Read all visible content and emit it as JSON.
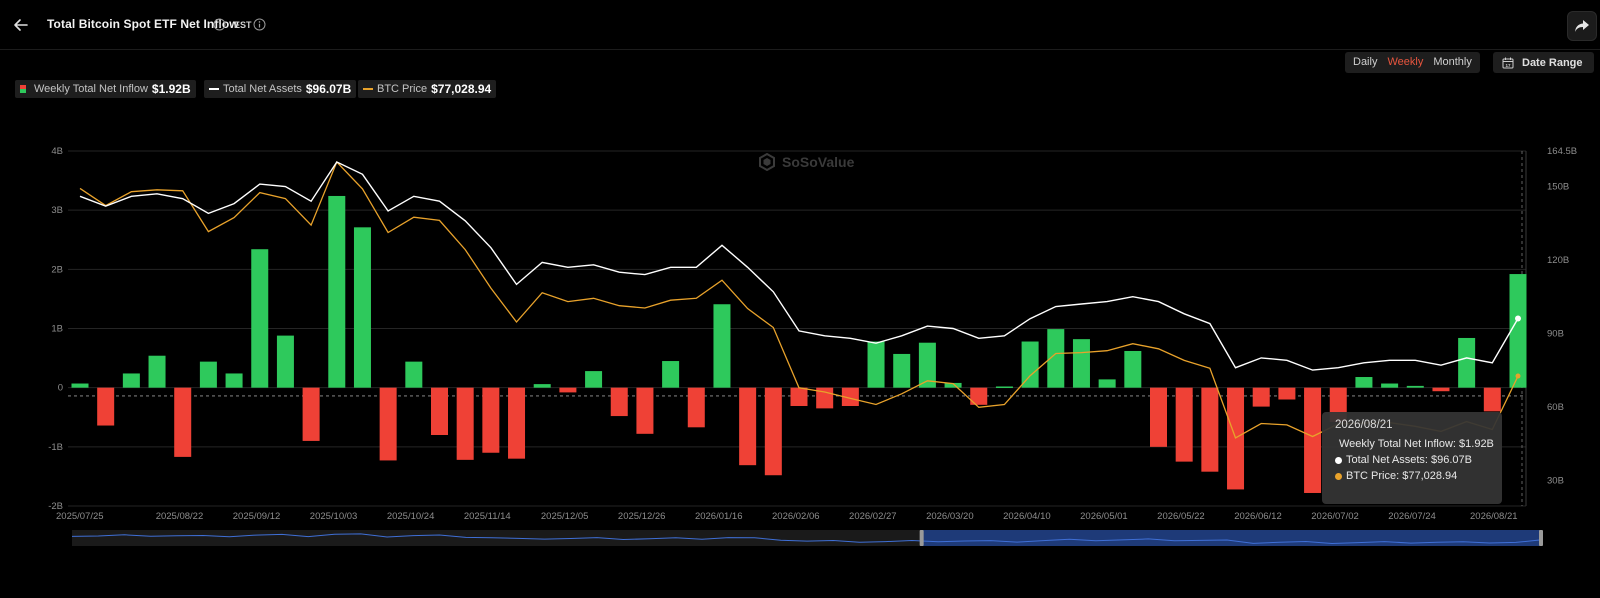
{
  "header": {
    "title": "Total Bitcoin Spot ETF Net Inflow",
    "timezone": "EST"
  },
  "controls": {
    "periods": [
      "Daily",
      "Weekly",
      "Monthly"
    ],
    "active_period": "Weekly",
    "date_range_label": "Date Range"
  },
  "legend": {
    "inflow_label": "Weekly Total Net Inflow",
    "inflow_value": "$1.92B",
    "assets_label": "Total Net Assets",
    "assets_value": "$96.07B",
    "price_label": "BTC Price",
    "price_value": "$77,028.94"
  },
  "tooltip": {
    "date": "2026/08/21",
    "inflow": "Weekly Total Net Inflow: $1.92B",
    "assets": "Total Net Assets: $96.07B",
    "price": "BTC Price: $77,028.94"
  },
  "watermark": "SoSoValue",
  "colors": {
    "positive": "#2ec95c",
    "negative": "#ef4136",
    "assets_line": "#ffffff",
    "price_line": "#e8a22b",
    "active_period": "#e8553e"
  },
  "chart_data": {
    "type": "bar",
    "x_tick_labels": [
      "2025/07/25",
      "2025/08/22",
      "2025/09/12",
      "2025/10/03",
      "2025/10/24",
      "2025/11/14",
      "2025/12/05",
      "2025/12/26",
      "2026/01/16",
      "2026/02/06",
      "2026/02/27",
      "2026/03/20",
      "2026/04/10",
      "2026/05/01",
      "2026/05/22",
      "2026/06/12",
      "2026/07/02",
      "2026/07/24",
      "2026/08/21"
    ],
    "y_left_ticks": [
      "4B",
      "3B",
      "2B",
      "1B",
      "0",
      "-1B",
      "-2B"
    ],
    "y_right_ticks": [
      "164.5B",
      "150B",
      "120B",
      "90B",
      "60B",
      "30B"
    ],
    "ylim_left": [
      -2,
      4
    ],
    "ylim_right": [
      19.5,
      164.5
    ],
    "series": [
      {
        "name": "Weekly Total Net Inflow",
        "unit": "B USD",
        "values": [
          0.07,
          -0.64,
          0.24,
          0.54,
          -1.17,
          0.44,
          0.24,
          2.34,
          0.88,
          -0.9,
          3.24,
          2.71,
          -1.23,
          0.44,
          -0.8,
          -1.22,
          -1.1,
          -1.2,
          0.06,
          -0.08,
          0.28,
          -0.48,
          -0.78,
          0.45,
          -0.67,
          1.41,
          -1.31,
          -1.48,
          -0.31,
          -0.35,
          -0.31,
          0.78,
          0.57,
          0.76,
          0.08,
          -0.29,
          0.02,
          0.78,
          0.99,
          0.82,
          0.14,
          0.62,
          -1.0,
          -1.25,
          -1.42,
          -1.72,
          -0.32,
          -0.2,
          -1.78,
          -0.58,
          0.18,
          0.07,
          0.03,
          -0.06,
          0.84,
          -0.4,
          1.92
        ]
      },
      {
        "name": "Total Net Assets",
        "unit": "B USD",
        "values": [
          146,
          142,
          146,
          147,
          145,
          139,
          143,
          151,
          150,
          144,
          160,
          155,
          140,
          146,
          144,
          136,
          125,
          110,
          119,
          117,
          118,
          115,
          114,
          117,
          117,
          126,
          117,
          107,
          91,
          89,
          88,
          86,
          89,
          93,
          92,
          88,
          89,
          96,
          101,
          102,
          103,
          105,
          103,
          98,
          94,
          76,
          80,
          79,
          75,
          76,
          78,
          79,
          79,
          77,
          80,
          78,
          96.07
        ]
      },
      {
        "name": "BTC Price",
        "unit": "USD",
        "values": [
          117500,
          113800,
          116800,
          117200,
          117000,
          108200,
          111200,
          116600,
          115300,
          109600,
          123200,
          117400,
          108000,
          111300,
          110600,
          104300,
          96000,
          88700,
          95000,
          93100,
          93800,
          92200,
          91700,
          93400,
          93800,
          97700,
          91600,
          87500,
          74500,
          73600,
          72200,
          70900,
          73200,
          76000,
          75400,
          70300,
          70900,
          77100,
          81900,
          82100,
          82500,
          84000,
          82900,
          80400,
          78700,
          63700,
          66800,
          66500,
          64000,
          66700,
          66900,
          67000,
          66200,
          65100,
          67200,
          65500,
          77028.94
        ]
      }
    ]
  }
}
